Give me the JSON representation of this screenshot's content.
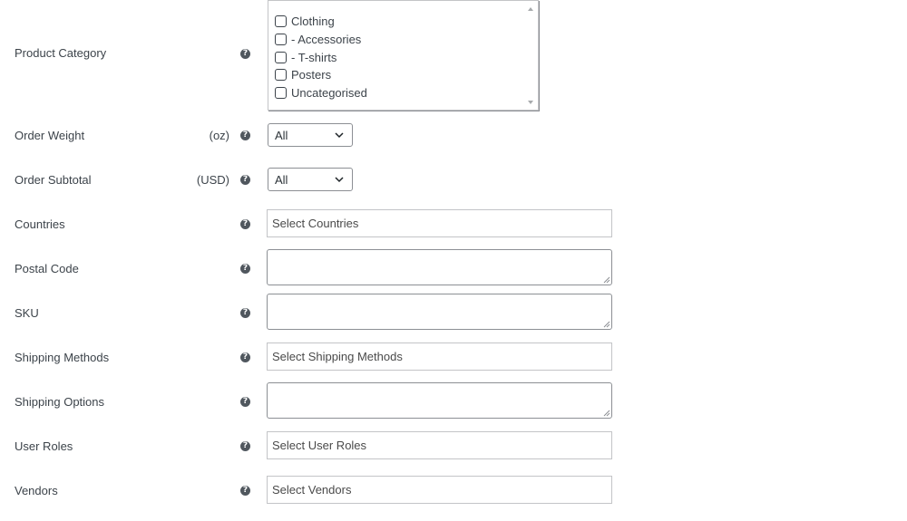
{
  "fields": {
    "product_category": {
      "label": "Product Category"
    },
    "order_weight": {
      "label": "Order Weight",
      "unit": "(oz)",
      "value": "All"
    },
    "order_subtotal": {
      "label": "Order Subtotal",
      "unit": "(USD)",
      "value": "All"
    },
    "countries": {
      "label": "Countries",
      "placeholder": "Select Countries"
    },
    "postal_code": {
      "label": "Postal Code",
      "value": ""
    },
    "sku": {
      "label": "SKU",
      "value": ""
    },
    "shipping_methods": {
      "label": "Shipping Methods",
      "placeholder": "Select Shipping Methods"
    },
    "shipping_options": {
      "label": "Shipping Options",
      "value": ""
    },
    "user_roles": {
      "label": "User Roles",
      "placeholder": "Select User Roles"
    },
    "vendors": {
      "label": "Vendors",
      "placeholder": "Select Vendors"
    }
  },
  "categories": [
    {
      "label": "Clothing",
      "checked": false
    },
    {
      "label": "- Accessories",
      "checked": false
    },
    {
      "label": "- T-shirts",
      "checked": false
    },
    {
      "label": "Posters",
      "checked": false
    },
    {
      "label": "Uncategorised",
      "checked": false
    }
  ],
  "help_glyph": "?",
  "icons": {
    "help": "help-circle-icon",
    "select": "chevron-down-icon",
    "scroll_up": "scroll-up-arrow-icon",
    "scroll_down": "scroll-down-arrow-icon"
  },
  "colors": {
    "text": "#3c434a",
    "border": "#c3c4c7",
    "input_border": "#8c8f94",
    "help_icon": "#50575e"
  }
}
